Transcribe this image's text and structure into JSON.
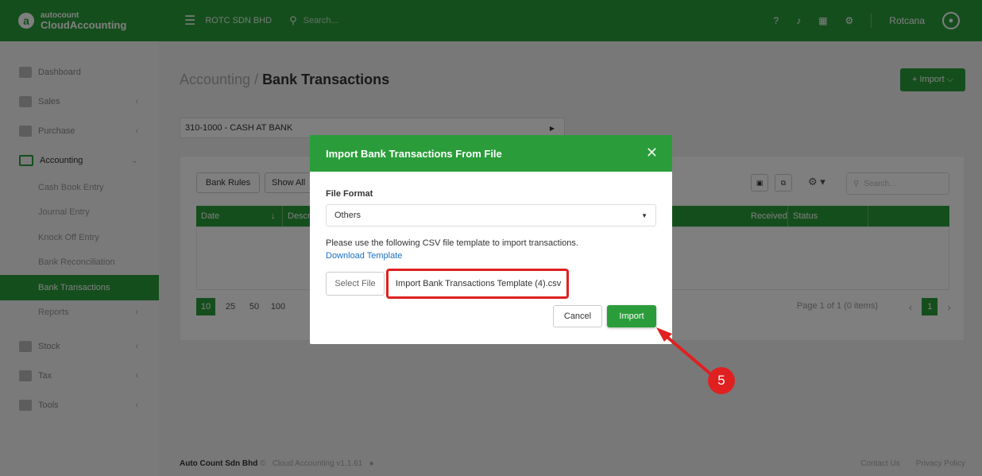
{
  "app": {
    "brand_small": "autocount",
    "brand_big": "CloudAccounting",
    "logo_letter": "a"
  },
  "header": {
    "company": "ROTC SDN BHD",
    "search_placeholder": "Search...",
    "username": "Rotcana"
  },
  "sidebar": {
    "items": [
      {
        "label": "Dashboard",
        "icon": "dashboard-icon"
      },
      {
        "label": "Sales",
        "icon": "sales-icon"
      },
      {
        "label": "Purchase",
        "icon": "purchase-icon"
      },
      {
        "label": "Accounting",
        "icon": "accounting-icon"
      }
    ],
    "accounting_sub": [
      "Cash Book Entry",
      "Journal Entry",
      "Knock Off Entry",
      "Bank Reconciliation",
      "Bank Transactions",
      "Reports"
    ],
    "items_after": [
      {
        "label": "Stock",
        "icon": "stock-icon"
      },
      {
        "label": "Tax",
        "icon": "tax-icon"
      },
      {
        "label": "Tools",
        "icon": "tools-icon"
      }
    ]
  },
  "page": {
    "breadcrumb_parent": "Accounting / ",
    "title": "Bank Transactions",
    "import_button": "+ Import ⌵",
    "account": "310-1000 - CASH AT BANK"
  },
  "toolbar": {
    "bank_rules": "Bank Rules",
    "show_all": "Show All",
    "search_placeholder": "Search..."
  },
  "table": {
    "columns": [
      "Date",
      "Descr",
      "Received",
      "Status"
    ]
  },
  "pager": {
    "sizes": [
      "10",
      "25",
      "50",
      "100"
    ],
    "info": "Page 1 of 1 (0 items)",
    "current": "1"
  },
  "footer": {
    "company": "Auto Count Sdn Bhd",
    "copyright": "©",
    "version": "Cloud Accounting v1.1.61",
    "contact": "Contact Us",
    "privacy": "Privacy Policy"
  },
  "modal": {
    "title": "Import Bank Transactions From File",
    "format_label": "File Format",
    "format_value": "Others",
    "note": "Please use the following CSV file template to import transactions.",
    "download_link": "Download Template",
    "select_file": "Select File",
    "file_name": "Import Bank Transactions Template (4).csv",
    "cancel": "Cancel",
    "import": "Import"
  },
  "annotation": {
    "step": "5"
  },
  "colors": {
    "brand_green": "#2a9d3a",
    "highlight_red": "#e02020"
  }
}
